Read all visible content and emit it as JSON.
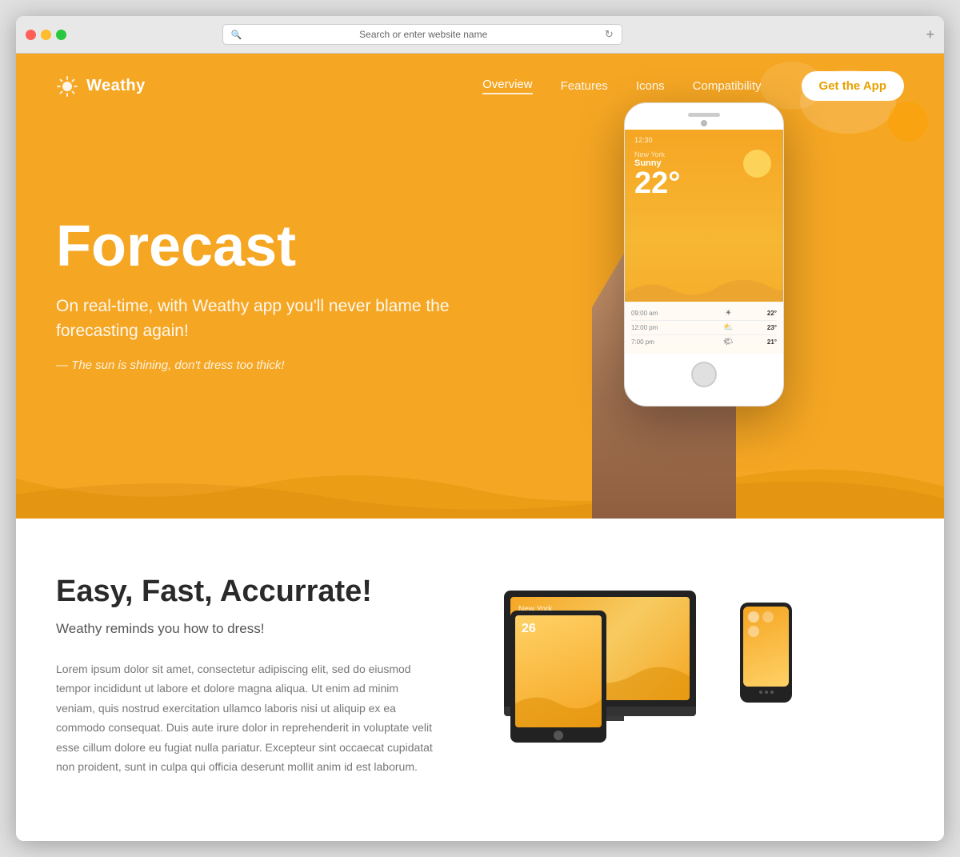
{
  "browser": {
    "address": "Search or enter website name",
    "plus_icon": "+"
  },
  "navbar": {
    "brand_name": "Weathy",
    "links": [
      {
        "label": "Overview",
        "active": true
      },
      {
        "label": "Features",
        "active": false
      },
      {
        "label": "Icons",
        "active": false
      },
      {
        "label": "Compatibility",
        "active": false
      }
    ],
    "cta_button": "Get the App"
  },
  "hero": {
    "title": "Forecast",
    "subtitle": "On real-time, with Weathy app you'll never blame the forecasting again!",
    "tagline": "— The sun is shining, don't dress too thick!",
    "phone_condition": "Sunny",
    "phone_temp": "22°",
    "forecast": [
      {
        "time": "09:00 am",
        "icon": "☀",
        "temp": "22°"
      },
      {
        "time": "12:00 pm",
        "icon": "⛅",
        "temp": "23°"
      },
      {
        "time": "7:00 pm",
        "icon": "🌤",
        "temp": "21°"
      }
    ]
  },
  "features": {
    "title": "Easy, Fast, Accurrate!",
    "subtitle": "Weathy reminds you how to dress!",
    "body": "Lorem ipsum dolor sit amet, consectetur adipiscing elit, sed do eiusmod tempor incididunt ut labore et dolore magna aliqua. Ut enim ad minim veniam, quis nostrud exercitation ullamco laboris nisi ut aliquip ex ea commodo consequat. Duis aute irure dolor in reprehenderit in voluptate velit esse cillum dolore eu fugiat nulla pariatur. Excepteur sint occaecat cupidatat non proident, sunt in culpa qui officia deserunt mollit anim id est laborum.",
    "laptop_temp": "26",
    "devices_shown": [
      "laptop",
      "tablet",
      "phone"
    ]
  },
  "colors": {
    "hero_bg": "#F5A623",
    "white": "#ffffff",
    "text_dark": "#2a2a2a",
    "text_medium": "#555555",
    "text_light": "#777777"
  }
}
